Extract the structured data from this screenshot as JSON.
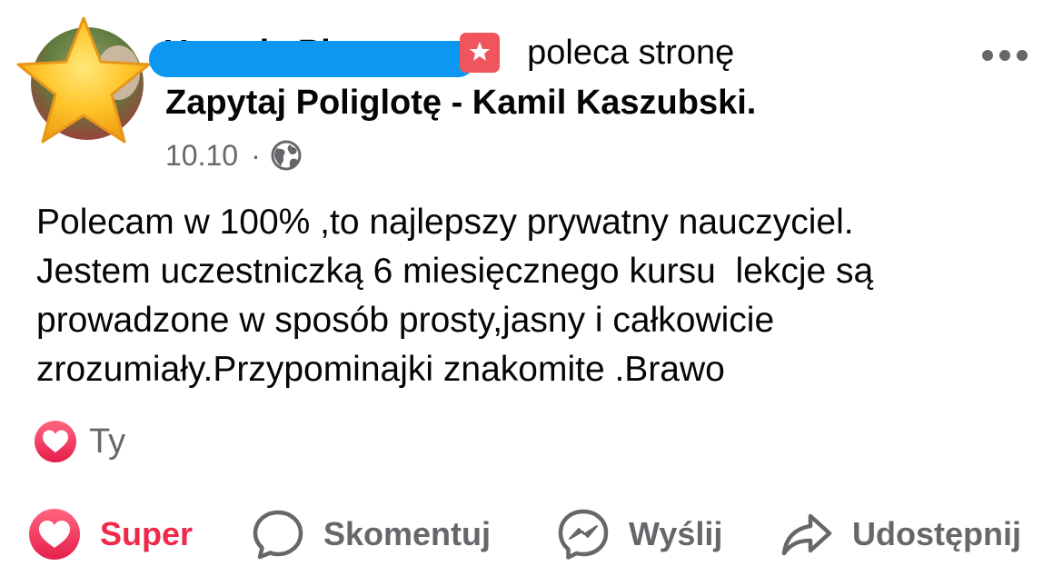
{
  "post": {
    "author": {
      "name": "Urszula Pieczner",
      "recommends_text": "poleca stronę"
    },
    "page_name": "Zapytaj Poliglotę - Kamil Kaszubski.",
    "date": "10.10",
    "meta_separator": "·",
    "audience_icon": "globe-icon",
    "body_lines": [
      "Polecam w 100% ,to najlepszy prywatny nauczyciel.",
      "Jestem uczestniczką 6 miesięcznego kursu  lekcje są",
      "prowadzone w sposób prosty,jasny i całkowicie",
      "zrozumiały.Przypominajki znakomite .Brawo"
    ],
    "reactions": {
      "icon": "heart-reaction-icon",
      "text": "Ty"
    }
  },
  "actions": {
    "like_label": "Super",
    "comment_label": "Skomentuj",
    "send_label": "Wyślij",
    "share_label": "Udostępnij"
  },
  "colors": {
    "text_primary": "#050505",
    "text_secondary": "#65676b",
    "like_active": "#f02849",
    "recommend_badge": "#f0545c",
    "redaction": "#0b97f2"
  }
}
